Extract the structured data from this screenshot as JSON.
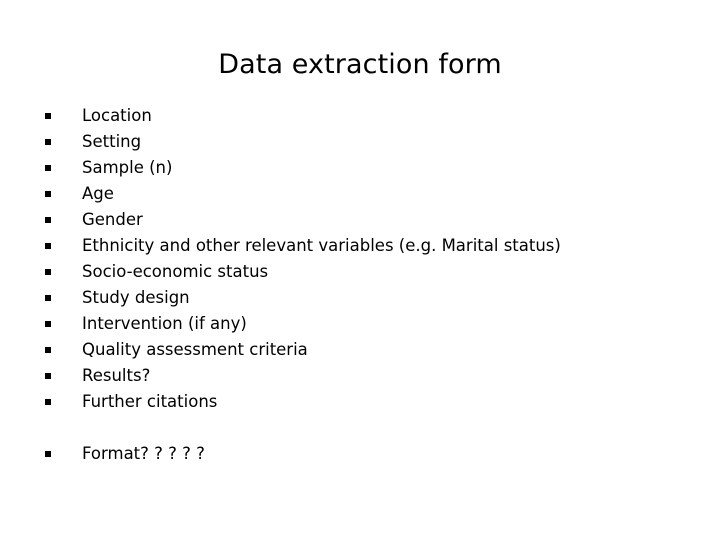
{
  "slide": {
    "title": "Data extraction form",
    "background_color": "#ffffff",
    "text_color": "#000000",
    "bullet_glyph": "filled-square",
    "items": [
      {
        "label": "Location",
        "spaced_before": false
      },
      {
        "label": "Setting",
        "spaced_before": false
      },
      {
        "label": "Sample (n)",
        "spaced_before": false
      },
      {
        "label": "Age",
        "spaced_before": false
      },
      {
        "label": "Gender",
        "spaced_before": false
      },
      {
        "label": "Ethnicity and other relevant variables (e.g. Marital status)",
        "spaced_before": false
      },
      {
        "label": "Socio-economic status",
        "spaced_before": false
      },
      {
        "label": "Study design",
        "spaced_before": false
      },
      {
        "label": "Intervention (if any)",
        "spaced_before": false
      },
      {
        "label": "Quality assessment criteria",
        "spaced_before": false
      },
      {
        "label": "Results?",
        "spaced_before": false
      },
      {
        "label": "Further citations",
        "spaced_before": false
      },
      {
        "label": "Format? ? ? ? ?",
        "spaced_before": true
      }
    ]
  }
}
